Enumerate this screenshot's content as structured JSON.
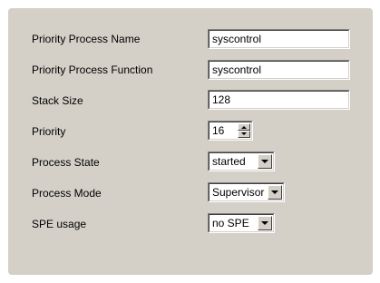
{
  "form": {
    "priority_process_name": {
      "label": "Priority Process Name",
      "value": "syscontrol"
    },
    "priority_process_function": {
      "label": "Priority Process Function",
      "value": "syscontrol"
    },
    "stack_size": {
      "label": "Stack Size",
      "value": "128"
    },
    "priority": {
      "label": "Priority",
      "value": "16"
    },
    "process_state": {
      "label": "Process State",
      "value": "started"
    },
    "process_mode": {
      "label": "Process Mode",
      "value": "Supervisor"
    },
    "spe_usage": {
      "label": "SPE usage",
      "value": "no SPE"
    }
  },
  "icons": {
    "dropdown": "chevron-down-icon",
    "spin_up": "spin-up-icon",
    "spin_down": "spin-down-icon"
  },
  "colors": {
    "panel_background": "#d4d0c8",
    "field_background": "#ffffff"
  }
}
